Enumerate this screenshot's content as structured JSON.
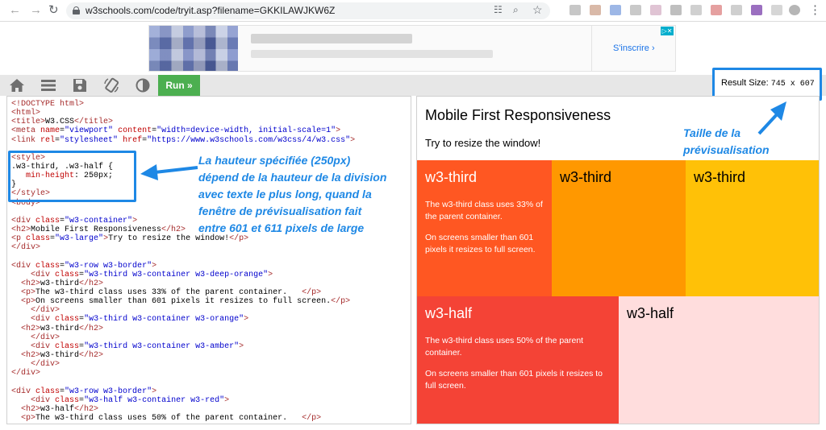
{
  "browser": {
    "url": "w3schools.com/code/tryit.asp?filename=GKKILAWJKW6Z",
    "back_icon": "←",
    "forward_icon": "→",
    "reload_icon": "↻",
    "star_icon": "☆",
    "zoom_icon": "⌕",
    "translate_icon": "☷",
    "menu_icon": "⋮"
  },
  "ad": {
    "cta": "S'inscrire ›",
    "badge": "▷✕"
  },
  "toolbar": {
    "run_label": "Run »",
    "result_size_label": "Result Size:",
    "result_size_value": "745 x 607"
  },
  "annotations": {
    "style_note": "La hauteur spécifiée (250px)\ndépend de la hauteur de la division\navec texte le plus long, quand la\nfenêtre de prévisualisation fait\nentre 601 et 611 pixels de large",
    "preview_note": "Taille de la\nprévisualisation"
  },
  "code_lines": [
    [
      [
        "t",
        "<!DOCTYPE html>"
      ]
    ],
    [
      [
        "t",
        "<html>"
      ]
    ],
    [
      [
        "t",
        "<title>"
      ],
      [
        "x",
        "W3.CSS"
      ],
      [
        "t",
        "</title>"
      ]
    ],
    [
      [
        "t",
        "<meta "
      ],
      [
        "a",
        "name"
      ],
      [
        "x",
        "="
      ],
      [
        "s",
        "\"viewport\""
      ],
      [
        "x",
        " "
      ],
      [
        "a",
        "content"
      ],
      [
        "x",
        "="
      ],
      [
        "s",
        "\"width=device-width, initial-scale=1\""
      ],
      [
        "t",
        ">"
      ]
    ],
    [
      [
        "t",
        "<link "
      ],
      [
        "a",
        "rel"
      ],
      [
        "x",
        "="
      ],
      [
        "s",
        "\"stylesheet\""
      ],
      [
        "x",
        " "
      ],
      [
        "a",
        "href"
      ],
      [
        "x",
        "="
      ],
      [
        "s",
        "\"https://www.w3schools.com/w3css/4/w3.css\""
      ],
      [
        "t",
        ">"
      ]
    ],
    [
      [
        "x",
        ""
      ]
    ],
    [
      [
        "t",
        "<style>"
      ]
    ],
    [
      [
        "x",
        ".w3-third, .w3-half {"
      ]
    ],
    [
      [
        "x",
        "   "
      ],
      [
        "a",
        "min-height"
      ],
      [
        "x",
        ": "
      ],
      [
        "x",
        "250px;"
      ]
    ],
    [
      [
        "x",
        "}"
      ]
    ],
    [
      [
        "t",
        "</style>"
      ]
    ],
    [
      [
        "t",
        "<body>"
      ]
    ],
    [
      [
        "x",
        ""
      ]
    ],
    [
      [
        "t",
        "<div "
      ],
      [
        "a",
        "class"
      ],
      [
        "x",
        "="
      ],
      [
        "s",
        "\"w3-container\""
      ],
      [
        "t",
        ">"
      ]
    ],
    [
      [
        "t",
        "<h2>"
      ],
      [
        "x",
        "Mobile First Responsiveness"
      ],
      [
        "t",
        "</h2>"
      ]
    ],
    [
      [
        "t",
        "<p "
      ],
      [
        "a",
        "class"
      ],
      [
        "x",
        "="
      ],
      [
        "s",
        "\"w3-large\""
      ],
      [
        "t",
        ">"
      ],
      [
        "x",
        "Try to resize the window!"
      ],
      [
        "t",
        "</p>"
      ]
    ],
    [
      [
        "t",
        "</div>"
      ]
    ],
    [
      [
        "x",
        ""
      ]
    ],
    [
      [
        "t",
        "<div "
      ],
      [
        "a",
        "class"
      ],
      [
        "x",
        "="
      ],
      [
        "s",
        "\"w3-row w3-border\""
      ],
      [
        "t",
        ">"
      ]
    ],
    [
      [
        "x",
        "    "
      ],
      [
        "t",
        "<div "
      ],
      [
        "a",
        "class"
      ],
      [
        "x",
        "="
      ],
      [
        "s",
        "\"w3-third w3-container w3-deep-orange\""
      ],
      [
        "t",
        ">"
      ]
    ],
    [
      [
        "x",
        "  "
      ],
      [
        "t",
        "<h2>"
      ],
      [
        "x",
        "w3-third"
      ],
      [
        "t",
        "</h2>"
      ]
    ],
    [
      [
        "x",
        "  "
      ],
      [
        "t",
        "<p>"
      ],
      [
        "x",
        "The w3-third class uses 33% of the parent container.   "
      ],
      [
        "t",
        "</p>"
      ]
    ],
    [
      [
        "x",
        "  "
      ],
      [
        "t",
        "<p>"
      ],
      [
        "x",
        "On screens smaller than 601 pixels it resizes to full screen."
      ],
      [
        "t",
        "</p>"
      ]
    ],
    [
      [
        "x",
        "    "
      ],
      [
        "t",
        "</div>"
      ]
    ],
    [
      [
        "x",
        "    "
      ],
      [
        "t",
        "<div "
      ],
      [
        "a",
        "class"
      ],
      [
        "x",
        "="
      ],
      [
        "s",
        "\"w3-third w3-container w3-orange\""
      ],
      [
        "t",
        ">"
      ]
    ],
    [
      [
        "x",
        "  "
      ],
      [
        "t",
        "<h2>"
      ],
      [
        "x",
        "w3-third"
      ],
      [
        "t",
        "</h2>"
      ]
    ],
    [
      [
        "x",
        "    "
      ],
      [
        "t",
        "</div>"
      ]
    ],
    [
      [
        "x",
        "    "
      ],
      [
        "t",
        "<div "
      ],
      [
        "a",
        "class"
      ],
      [
        "x",
        "="
      ],
      [
        "s",
        "\"w3-third w3-container w3-amber\""
      ],
      [
        "t",
        ">"
      ]
    ],
    [
      [
        "x",
        "  "
      ],
      [
        "t",
        "<h2>"
      ],
      [
        "x",
        "w3-third"
      ],
      [
        "t",
        "</h2>"
      ]
    ],
    [
      [
        "x",
        "    "
      ],
      [
        "t",
        "</div>"
      ]
    ],
    [
      [
        "t",
        "</div>"
      ]
    ],
    [
      [
        "x",
        ""
      ]
    ],
    [
      [
        "t",
        "<div "
      ],
      [
        "a",
        "class"
      ],
      [
        "x",
        "="
      ],
      [
        "s",
        "\"w3-row w3-border\""
      ],
      [
        "t",
        ">"
      ]
    ],
    [
      [
        "x",
        "    "
      ],
      [
        "t",
        "<div "
      ],
      [
        "a",
        "class"
      ],
      [
        "x",
        "="
      ],
      [
        "s",
        "\"w3-half w3-container w3-red\""
      ],
      [
        "t",
        ">"
      ]
    ],
    [
      [
        "x",
        "  "
      ],
      [
        "t",
        "<h2>"
      ],
      [
        "x",
        "w3-half"
      ],
      [
        "t",
        "</h2>"
      ]
    ],
    [
      [
        "x",
        "  "
      ],
      [
        "t",
        "<p>"
      ],
      [
        "x",
        "The w3-third class uses 50% of the parent container.   "
      ],
      [
        "t",
        "</p>"
      ]
    ]
  ],
  "preview": {
    "title": "Mobile First Responsiveness",
    "subtitle": "Try to resize the window!",
    "row1": [
      {
        "heading": "w3-third",
        "bg": "#ff5722",
        "fg": "#ffffff",
        "paragraphs": [
          "The w3-third class uses 33% of the parent container.",
          "On screens smaller than 601 pixels it resizes to full screen."
        ]
      },
      {
        "heading": "w3-third",
        "bg": "#ff9800",
        "fg": "#000000",
        "paragraphs": []
      },
      {
        "heading": "w3-third",
        "bg": "#ffc107",
        "fg": "#000000",
        "paragraphs": []
      }
    ],
    "row2": [
      {
        "heading": "w3-half",
        "bg": "#f44336",
        "fg": "#ffffff",
        "paragraphs": [
          "The w3-third class uses 50% of the parent container.",
          "On screens smaller than 601 pixels it resizes to full screen."
        ]
      },
      {
        "heading": "w3-half",
        "bg": "#ffdddd",
        "fg": "#000000",
        "paragraphs": []
      }
    ]
  },
  "colors": {
    "accent_annotation": "#1e88e5",
    "run_button": "#4caf50",
    "toolbar": "#e7e7e7"
  }
}
